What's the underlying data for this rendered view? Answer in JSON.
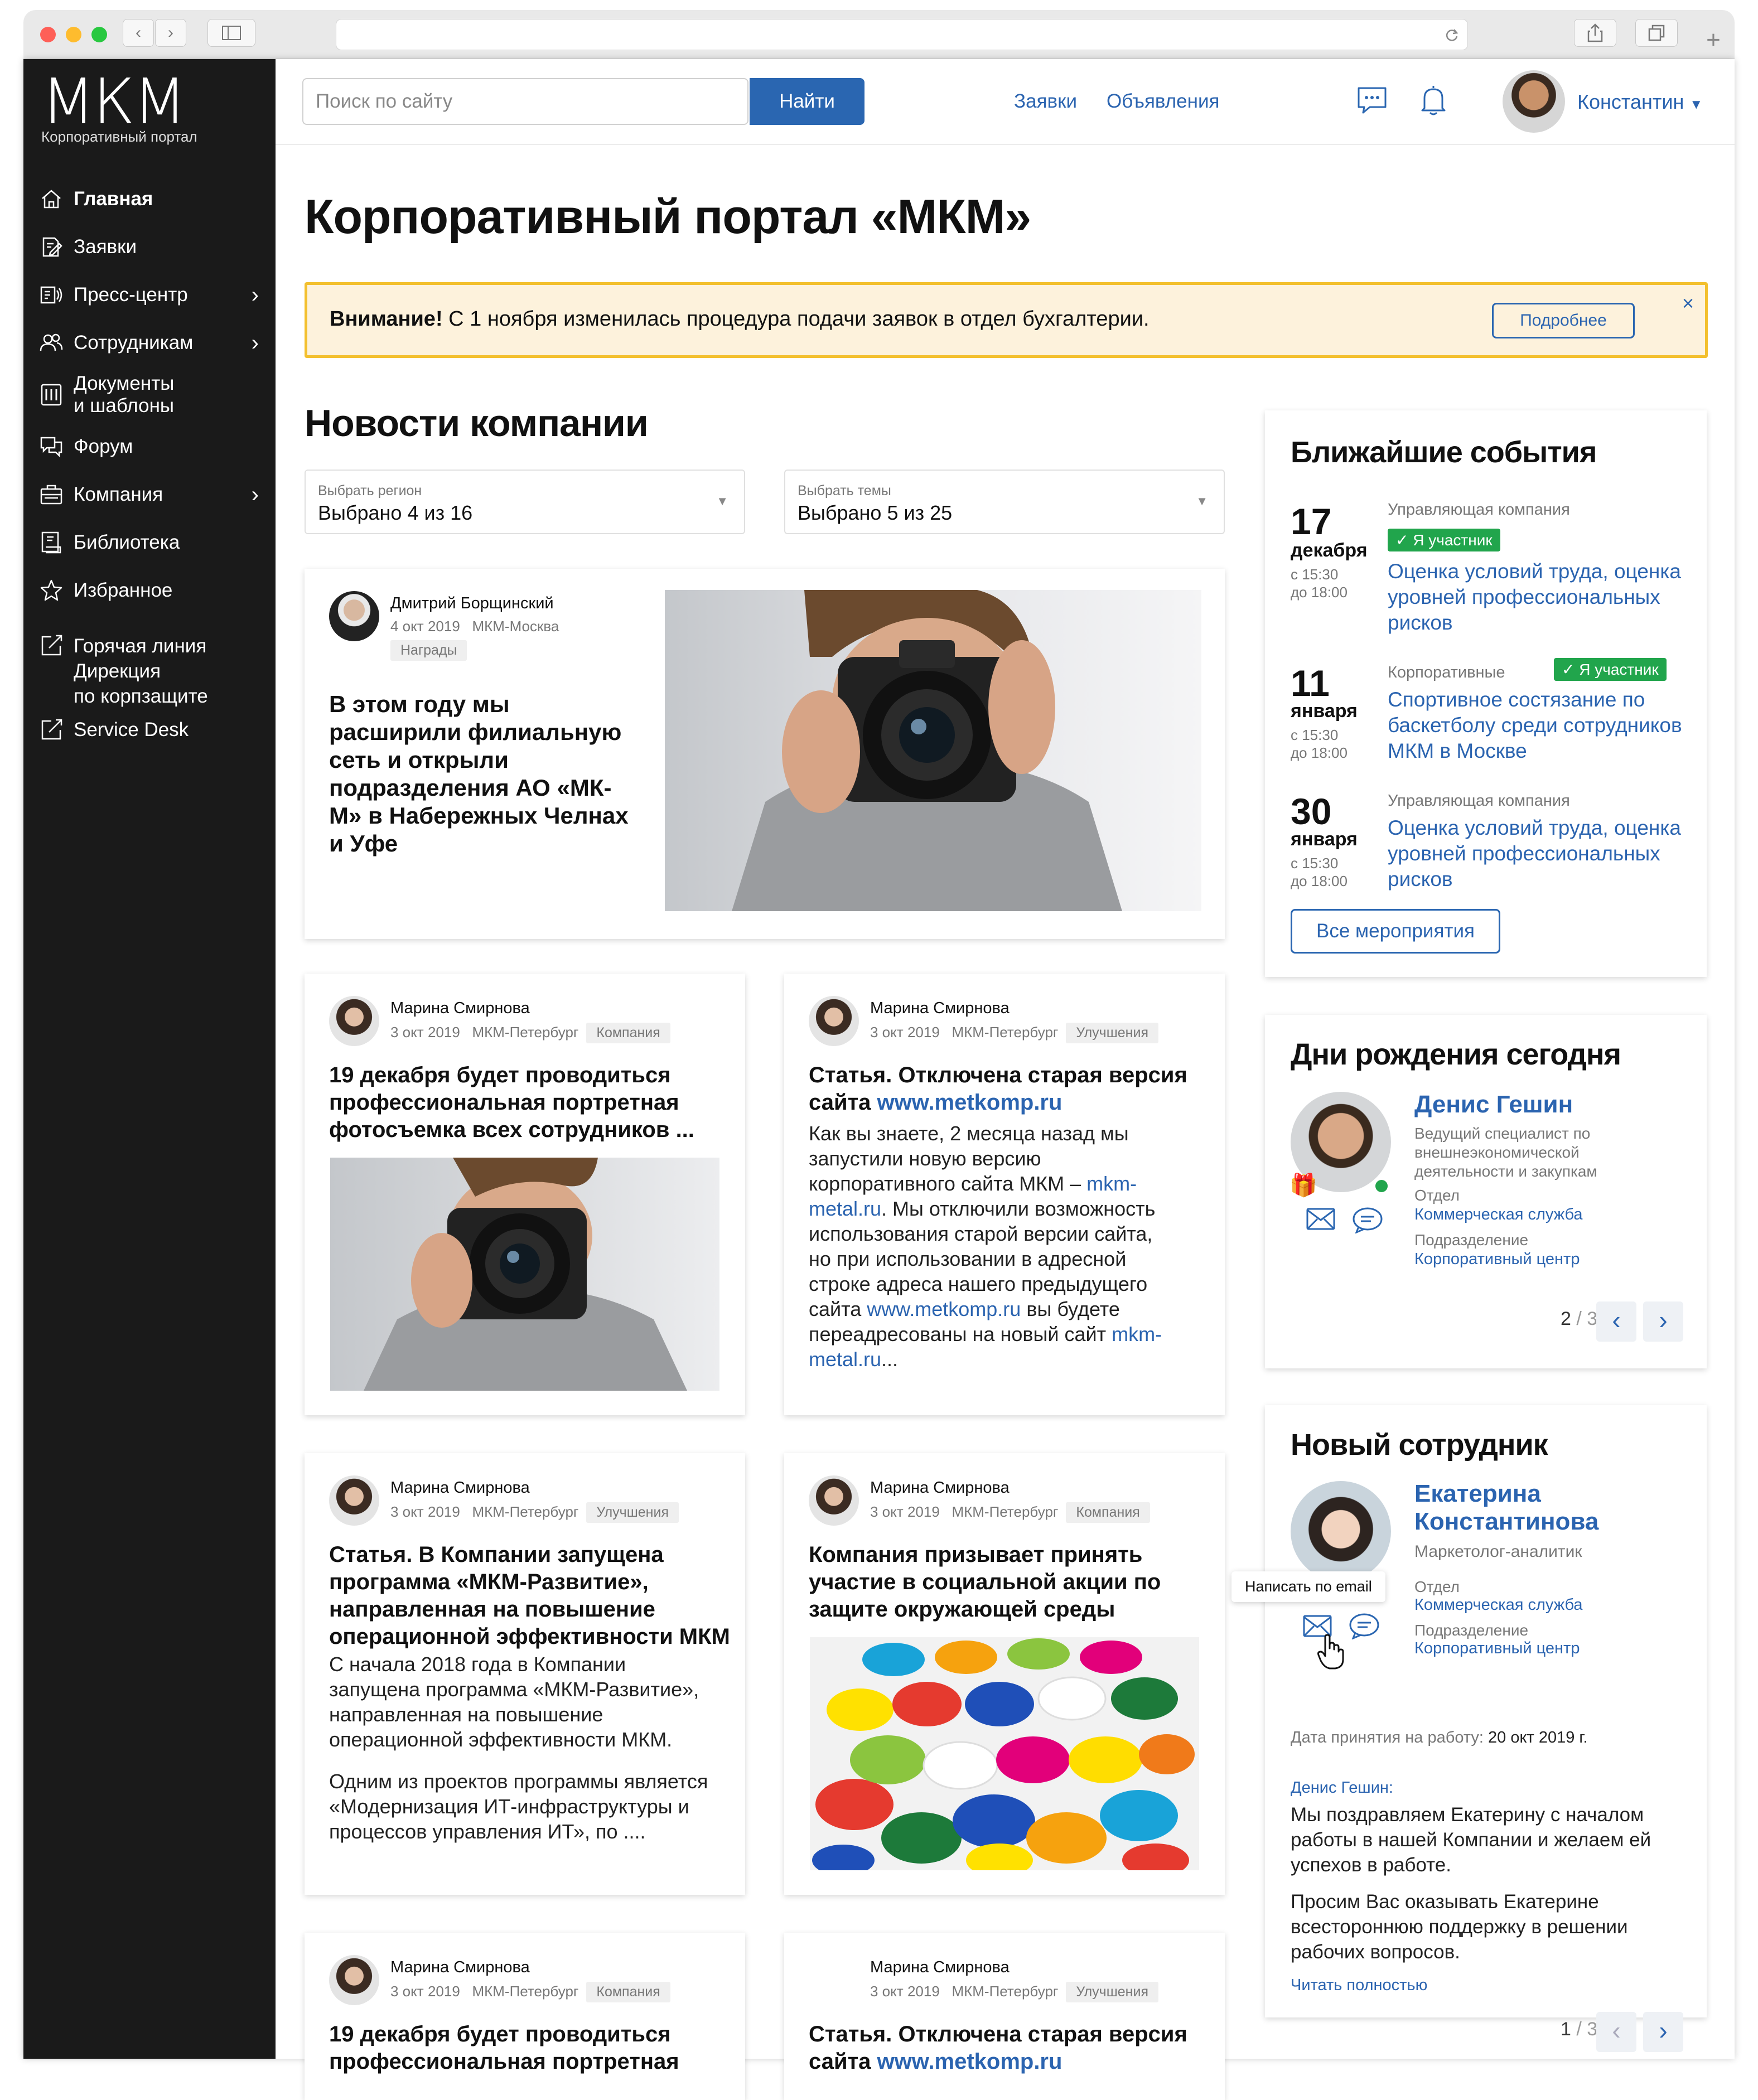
{
  "browser": {
    "back": "‹",
    "forward": "›"
  },
  "sidebar": {
    "logo_text": "МКМ",
    "logo_sub": "Корпоративный портал",
    "items": [
      {
        "label": "Главная",
        "icon": "home-icon"
      },
      {
        "label": "Заявки",
        "icon": "edit-document-icon"
      },
      {
        "label": "Пресс-центр",
        "icon": "megaphone-icon"
      },
      {
        "label": "Сотрудникам",
        "icon": "users-icon"
      },
      {
        "label": "Документы\nи шаблоны",
        "icon": "documents-icon"
      },
      {
        "label": "Форум",
        "icon": "forum-icon"
      },
      {
        "label": "Компания",
        "icon": "briefcase-icon"
      },
      {
        "label": "Библиотека",
        "icon": "library-icon"
      },
      {
        "label": "Избранное",
        "icon": "star-icon"
      },
      {
        "label": "Горячая линия\nДирекция\nпо корпзащите",
        "icon": "external-edit-icon"
      },
      {
        "label": "Service Desk",
        "icon": "external-edit-icon"
      }
    ]
  },
  "header": {
    "search_placeholder": "Поиск по сайту",
    "search_button": "Найти",
    "links": [
      "Заявки",
      "Объявления"
    ],
    "user_name": "Константин"
  },
  "main": {
    "title": "Корпоративный портал «МКМ»",
    "alert": {
      "strong": "Внимание!",
      "text": " С 1 ноября изменилась процедура подачи заявок в отдел бухгалтерии.",
      "button": "Подробнее",
      "close": "×"
    },
    "news_title": "Новости компании",
    "filters": [
      {
        "label": "Выбрать регион",
        "value": "Выбрано 4 из 16"
      },
      {
        "label": "Выбрать темы",
        "value": "Выбрано 5 из 25"
      }
    ],
    "featured": {
      "author": "Дмитрий Борщинский",
      "date": "4 окт 2019",
      "office": "МКМ-Москва",
      "tag": "Награды",
      "title": "В этом году мы расширили филиальную сеть и открыли подразделения АО «МК-М» в Набережных Челнах и Уфе"
    },
    "cards": [
      {
        "author": "Марина Смирнова",
        "date": "3 окт 2019",
        "office": "МКМ-Петербург",
        "tag": "Компания",
        "title": "19 декабря будет проводиться профессиональная портретная фотосъемка всех сотрудников ..."
      },
      {
        "author": "Марина Смирнова",
        "date": "3 окт 2019",
        "office": "МКМ-Петербург",
        "tag": "Улучшения",
        "title_pre": "Статья. Отключена старая версия сайта ",
        "title_link": "www.metkomp.ru",
        "body": [
          {
            "t": "Как вы знаете, 2 месяца назад мы запустили новую версию корпоративного сайта МКМ – "
          },
          {
            "l": "mkm-metal.ru"
          },
          {
            "t": ". Мы отключили возможность использования старой версии сайта, но при использовании в адресной строке адреса нашего предыдущего сайта "
          },
          {
            "l": "www.metkomp.ru"
          },
          {
            "t": " вы будете переадресованы на новый сайт "
          },
          {
            "l": "mkm-metal.ru"
          },
          {
            "t": "..."
          }
        ]
      },
      {
        "author": "Марина Смирнова",
        "date": "3 окт 2019",
        "office": "МКМ-Петербург",
        "tag": "Улучшения",
        "title": "Статья. В Компании запущена программа «МКМ-Развитие», направленная на повышение операционной эффективности МКМ",
        "body1": "С начала 2018 года в Компании запущена программа «МКМ-Развитие», направленная на повышение операционной эффективности МКМ.",
        "body2": "Одним из проектов программы является «Модернизация ИТ-инфраструктуры и процессов управления ИТ», по ...."
      },
      {
        "author": "Марина Смирнова",
        "date": "3 окт 2019",
        "office": "МКМ-Петербург",
        "tag": "Компания",
        "title": "Компания призывает принять участие в социальной акции по защите окружающей среды"
      },
      {
        "author": "Марина Смирнова",
        "date": "3 окт 2019",
        "office": "МКМ-Петербург",
        "tag": "Компания",
        "title": "19 декабря будет проводиться профессиональная портретная"
      },
      {
        "author": "Марина Смирнова",
        "date": "3 окт 2019",
        "office": "МКМ-Петербург",
        "tag": "Улучшения",
        "title_pre": "Статья. Отключена старая версия сайта ",
        "title_link": "www.metkomp.ru"
      }
    ]
  },
  "events": {
    "title": "Ближайшие события",
    "items": [
      {
        "day": "17",
        "month": "декабря",
        "from": "с 15:30",
        "to": "до 18:00",
        "category": "Управляющая компания",
        "badge": "Я участник",
        "title": "Оценка условий труда, оценка уровней профессиональных рисков"
      },
      {
        "day": "11",
        "month": "января",
        "from": "с 15:30",
        "to": "до 18:00",
        "category": "Корпоративные",
        "badge": "Я участник",
        "title": "Спортивное состязание по баскетболу среди сотрудников МКМ в Москве"
      },
      {
        "day": "30",
        "month": "января",
        "from": "с 15:30",
        "to": "до 18:00",
        "category": "Управляющая компания",
        "title": "Оценка условий труда, оценка уровней профессиональных рисков"
      }
    ],
    "all_button": "Все мероприятия"
  },
  "birthdays": {
    "title": "Дни рождения сегодня",
    "name": "Денис Гешин",
    "position": "Ведущий специалист по внешнеэкономической деятельности и закупкам",
    "dept_label": "Отдел",
    "dept": "Коммерческая служба",
    "unit_label": "Подразделение",
    "unit": "Корпоративный центр",
    "pager_current": "2",
    "pager_total": " / 3"
  },
  "newemployee": {
    "title": "Новый сотрудник",
    "name": "Екатерина Константинова",
    "position": "Маркетолог-аналитик",
    "dept_label": "Отдел",
    "dept": "Коммерческая служба",
    "unit_label": "Подразделение",
    "unit": "Корпоративный центр",
    "tooltip": "Написать по email",
    "hire_label": "Дата принятия на работу: ",
    "hire_date": "20 окт 2019 г.",
    "greeting_author": "Денис Гешин:",
    "greeting1": "Мы поздравляем Екатерину с началом работы в нашей Компании и желаем ей успехов в работе.",
    "greeting2": "Просим Вас оказывать Екатерине всестороннюю поддержку в решении рабочих вопросов.",
    "read_more": "Читать полностью",
    "pager_current": "1",
    "pager_total": " / 3"
  },
  "colors": {
    "accent": "#2a66b1",
    "alert_bg": "#fdf2dc",
    "alert_border": "#f3c02e",
    "badge": "#21a54c",
    "sidebar": "#1a1a1a"
  }
}
